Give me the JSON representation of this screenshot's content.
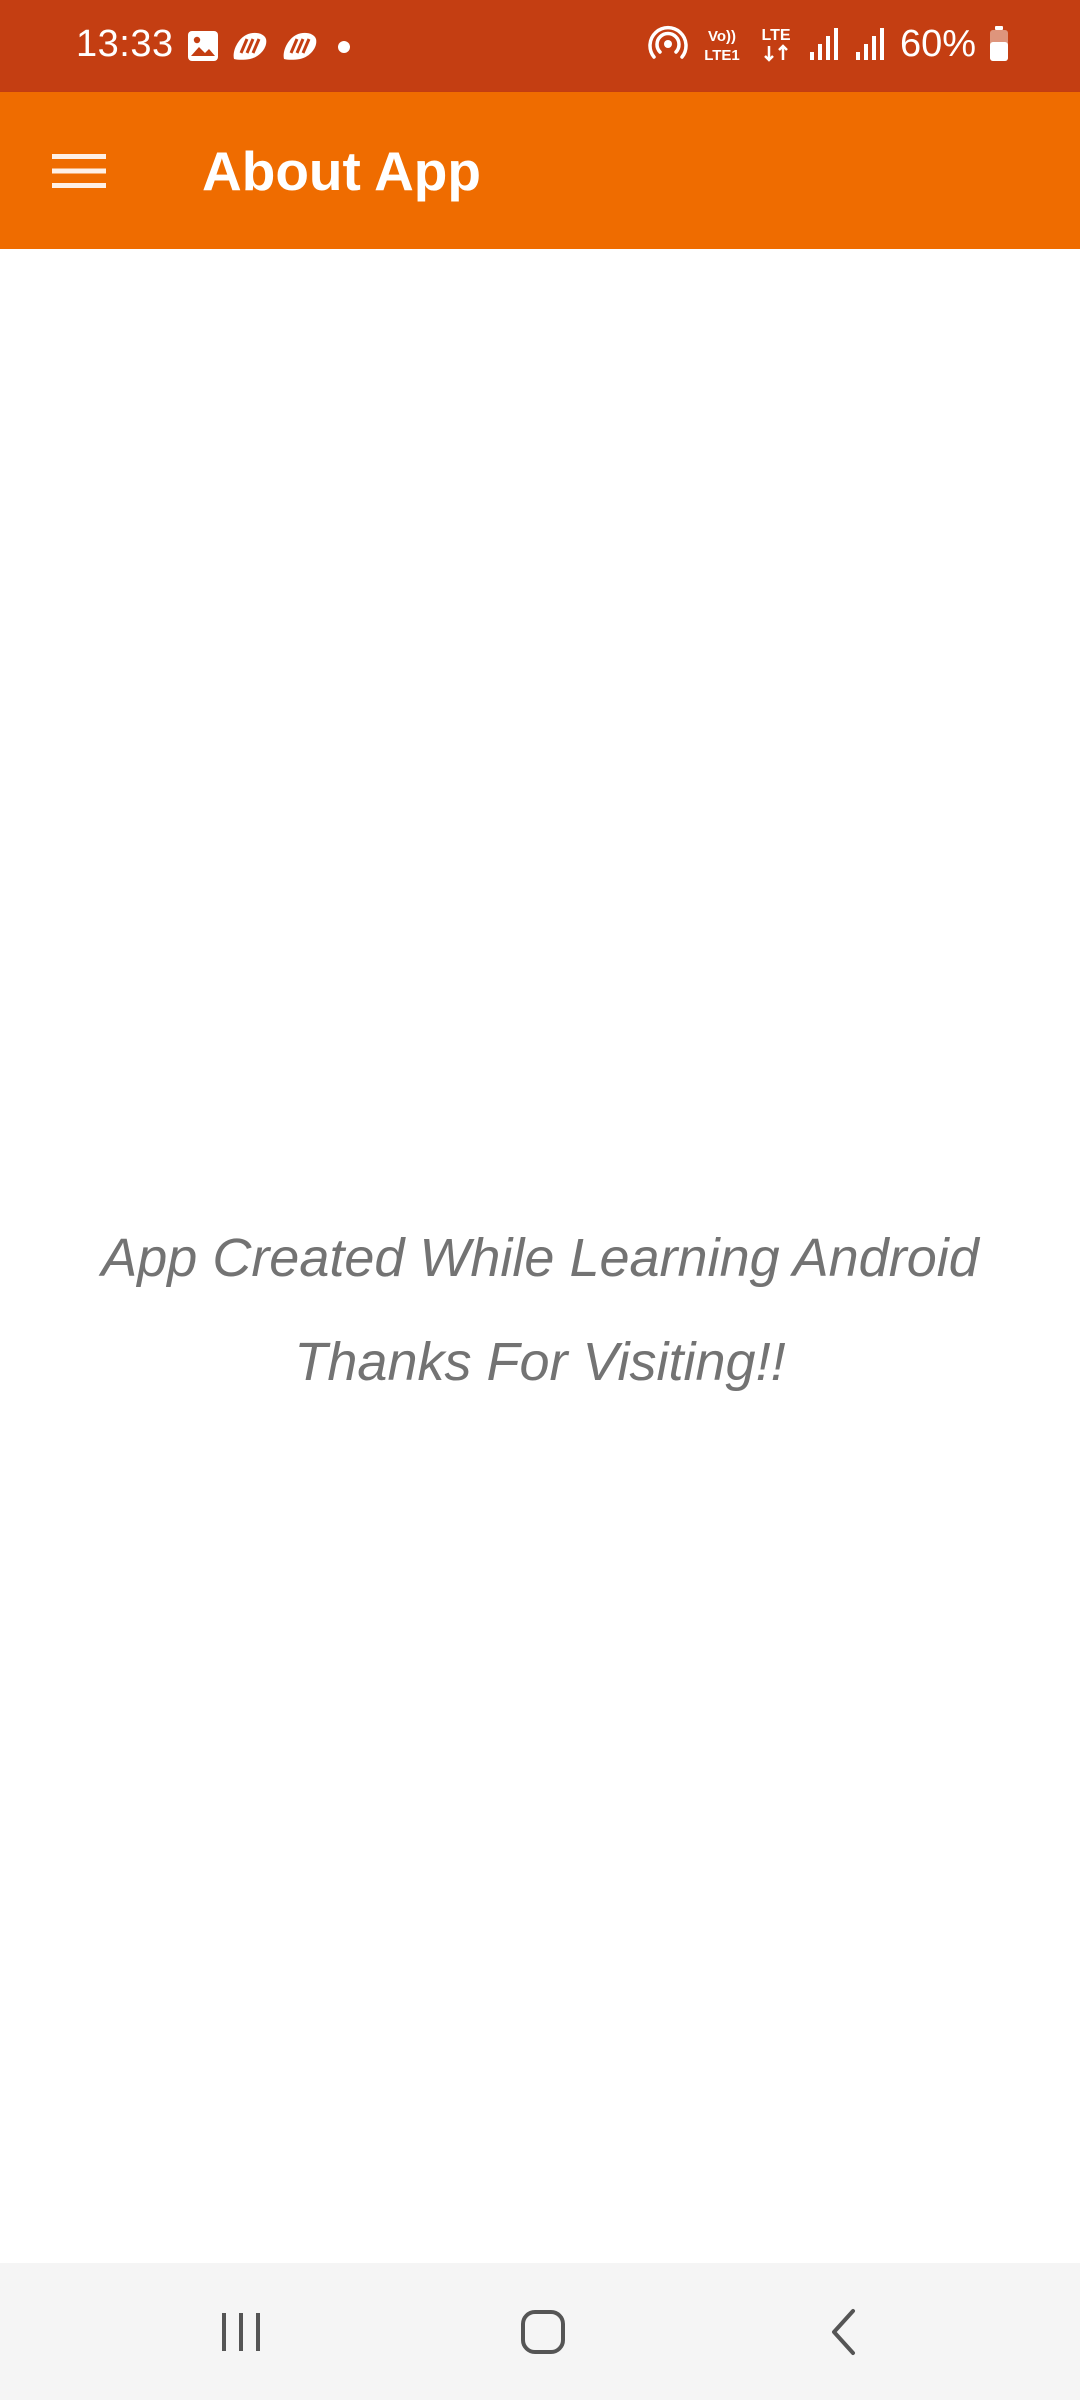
{
  "status_bar": {
    "time": "13:33",
    "battery": "60%",
    "left_icons": [
      "gallery-icon",
      "app-notification-icon",
      "app-notification-icon",
      "dot-icon"
    ],
    "right_icons": [
      "hotspot-icon",
      "volte-icon",
      "lte-data-icon",
      "signal-icon",
      "signal-icon",
      "battery-icon"
    ],
    "volte_top": "Vo))",
    "volte_bottom": "LTE1",
    "lte_label": "LTE"
  },
  "app_bar": {
    "title": "About App",
    "menu_icon": "hamburger-menu-icon"
  },
  "content": {
    "line1": "App Created While Learning Android",
    "line2": "Thanks For Visiting!!"
  },
  "nav_bar": {
    "buttons": [
      "recents-icon",
      "home-icon",
      "back-icon"
    ]
  },
  "colors": {
    "status_bar": "#C43E12",
    "app_bar": "#EF6C00",
    "text_gray": "#737373",
    "nav_bar": "#F5F5F5"
  }
}
